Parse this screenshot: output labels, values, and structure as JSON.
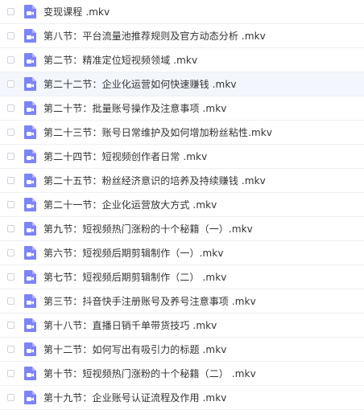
{
  "accent_color": "#7d84f7",
  "file_icon": "video-file-icon",
  "files": [
    {
      "name": "变现课程 .mkv"
    },
    {
      "name": "第八节：平台流量池推荐规则及官方动态分析 .mkv"
    },
    {
      "name": "第二节：精准定位短视频领域 .mkv"
    },
    {
      "name": "第二十二节：企业化运营如何快速赚钱 .mkv"
    },
    {
      "name": "第二十节：批量账号操作及注意事项 .mkv"
    },
    {
      "name": "第二十三节：账号日常维护及如何增加粉丝粘性.mkv"
    },
    {
      "name": "第二十四节：短视频创作者日常 .mkv"
    },
    {
      "name": "第二十五节：粉丝经济意识的培养及持续赚钱 .mkv"
    },
    {
      "name": "第二十一节：企业化运营放大方式 .mkv"
    },
    {
      "name": "第九节：短视频热门涨粉的十个秘籍（一）.mkv"
    },
    {
      "name": "第六节：短视频后期剪辑制作（一）.mkv"
    },
    {
      "name": "第七节：短视频后期剪辑制作（二） .mkv"
    },
    {
      "name": "第三节：抖音快手注册账号及养号注意事项 .mkv"
    },
    {
      "name": "第十八节：直播日销千单带货技巧 .mkv"
    },
    {
      "name": "第十二节：如何写出有吸引力的标题 .mkv"
    },
    {
      "name": "第十节：短视频热门涨粉的十个秘籍（二） .mkv"
    },
    {
      "name": "第十九节：企业账号认证流程及作用 .mkv"
    }
  ]
}
